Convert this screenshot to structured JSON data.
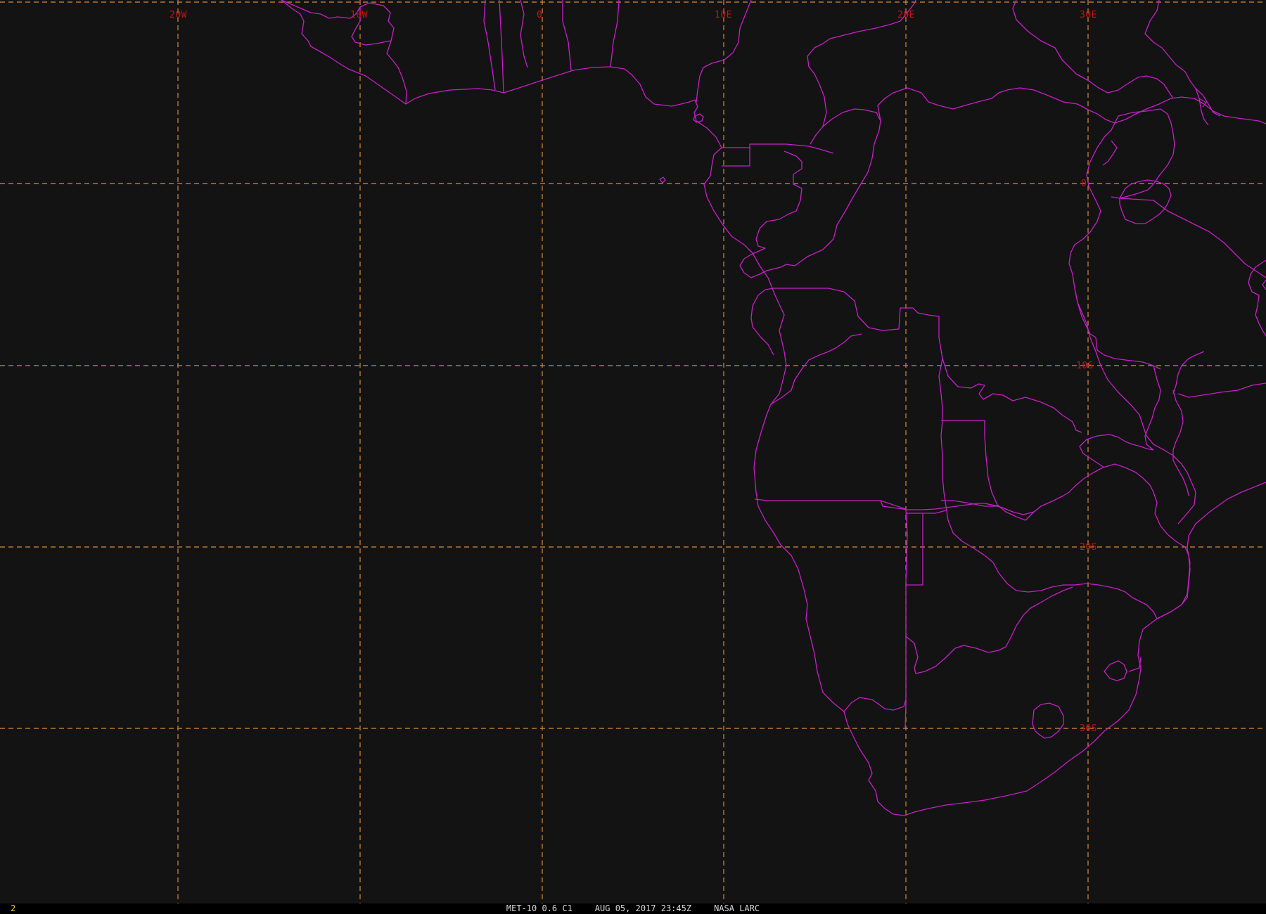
{
  "colors": {
    "background": "#131313",
    "grid": "#d98a3a",
    "borders": "#c81ec8",
    "grid_labels": "#c41414",
    "frame_number": "#e8d21e",
    "status_text": "#d8d8d8"
  },
  "map": {
    "longitude_labels": [
      "20W",
      "10W",
      "0",
      "10E",
      "20E",
      "30E"
    ],
    "latitude_labels": [
      "0",
      "10S",
      "20S",
      "30S"
    ],
    "gridline_style": "dashed"
  },
  "status_bar": {
    "frame_number": "2",
    "satellite": "MET-10 0.6 C1",
    "datetime": "AUG 05, 2017 23:45Z",
    "source": "NASA LARC"
  }
}
